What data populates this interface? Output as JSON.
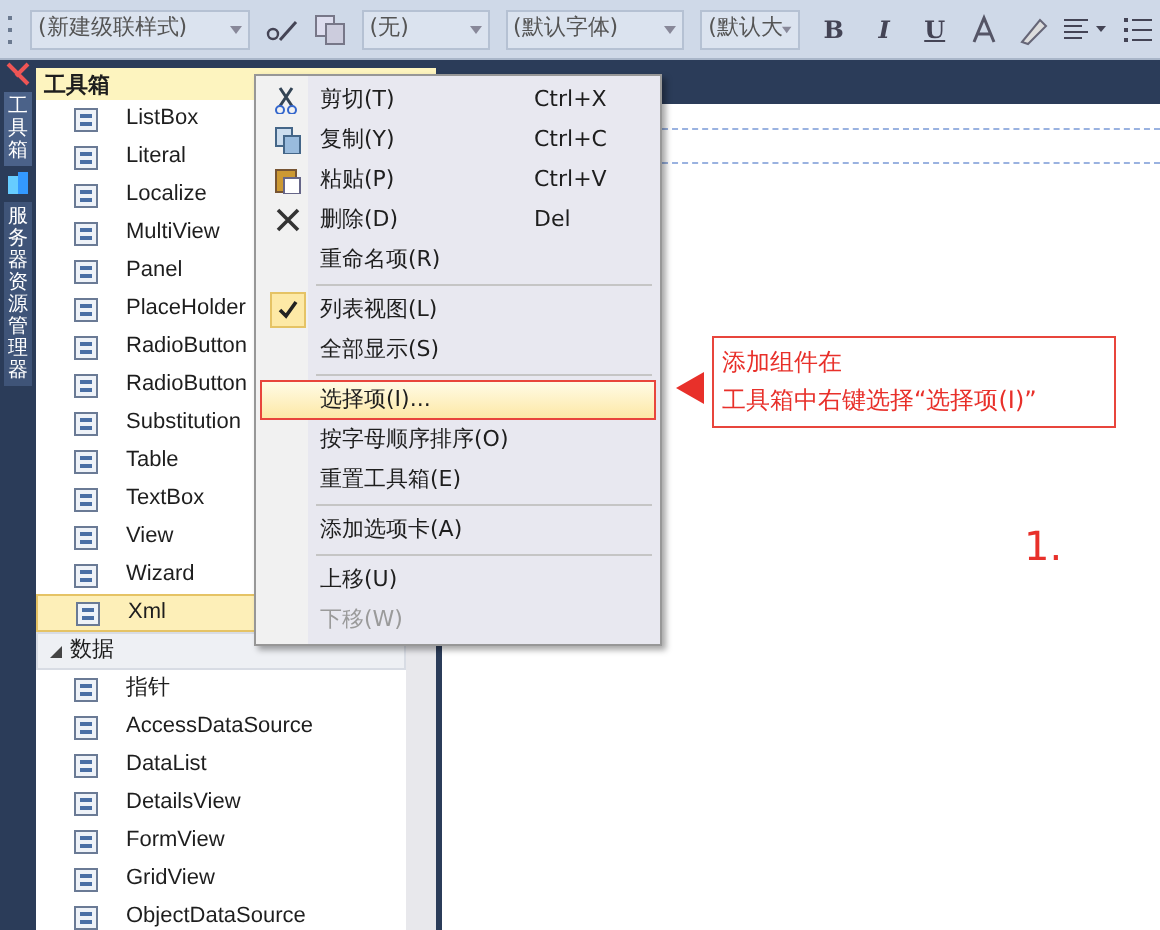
{
  "toolbar": {
    "dropdowns": [
      {
        "value": "(新建级联样式)"
      },
      {
        "value": "(无)"
      },
      {
        "value": "(默认字体)"
      },
      {
        "value": "(默认大"
      }
    ],
    "format_buttons": [
      "B",
      "I",
      "U"
    ]
  },
  "side_tabs": [
    {
      "label": "工具箱",
      "selected": true
    },
    {
      "label": "服务器资源管理器",
      "selected": false
    }
  ],
  "toolbox": {
    "title": "工具箱",
    "items": [
      {
        "label": "ListBox",
        "selected": false
      },
      {
        "label": "Literal",
        "selected": false
      },
      {
        "label": "Localize",
        "selected": false
      },
      {
        "label": "MultiView",
        "selected": false
      },
      {
        "label": "Panel",
        "selected": false
      },
      {
        "label": "PlaceHolder",
        "selected": false
      },
      {
        "label": "RadioButton",
        "selected": false
      },
      {
        "label": "RadioButton",
        "selected": false
      },
      {
        "label": "Substitution",
        "selected": false
      },
      {
        "label": "Table",
        "selected": false
      },
      {
        "label": "TextBox",
        "selected": false
      },
      {
        "label": "View",
        "selected": false
      },
      {
        "label": "Wizard",
        "selected": false
      },
      {
        "label": "Xml",
        "selected": true
      }
    ],
    "groups": [
      {
        "label": "数据",
        "expanded": true,
        "items": [
          {
            "label": "指针",
            "selected": false
          },
          {
            "label": "AccessDataSource",
            "selected": false
          },
          {
            "label": "DataList",
            "selected": false
          },
          {
            "label": "DetailsView",
            "selected": false
          },
          {
            "label": "FormView",
            "selected": false
          },
          {
            "label": "GridView",
            "selected": false
          },
          {
            "label": "ObjectDataSource",
            "selected": false
          }
        ]
      }
    ]
  },
  "context_menu": [
    {
      "kind": "item",
      "label": "剪切(T)",
      "shortcut": "Ctrl+X",
      "checked": false,
      "selected": false,
      "disabled": false
    },
    {
      "kind": "item",
      "label": "复制(Y)",
      "shortcut": "Ctrl+C",
      "checked": false,
      "selected": false,
      "disabled": false
    },
    {
      "kind": "item",
      "label": "粘贴(P)",
      "shortcut": "Ctrl+V",
      "checked": false,
      "selected": false,
      "disabled": false
    },
    {
      "kind": "item",
      "label": "删除(D)",
      "shortcut": "Del",
      "checked": false,
      "selected": false,
      "disabled": false
    },
    {
      "kind": "item",
      "label": "重命名项(R)",
      "checked": false,
      "selected": false,
      "disabled": false
    },
    {
      "kind": "separator"
    },
    {
      "kind": "item",
      "label": "列表视图(L)",
      "checked": true,
      "selected": false,
      "disabled": false
    },
    {
      "kind": "item",
      "label": "全部显示(S)",
      "checked": false,
      "selected": false,
      "disabled": false
    },
    {
      "kind": "separator"
    },
    {
      "kind": "item",
      "label": "选择项(I)...",
      "checked": false,
      "selected": true,
      "disabled": false
    },
    {
      "kind": "item",
      "label": "按字母顺序排序(O)",
      "checked": false,
      "selected": false,
      "disabled": false
    },
    {
      "kind": "item",
      "label": "重置工具箱(E)",
      "checked": false,
      "selected": false,
      "disabled": false
    },
    {
      "kind": "separator"
    },
    {
      "kind": "item",
      "label": "添加选项卡(A)",
      "checked": false,
      "selected": false,
      "disabled": false
    },
    {
      "kind": "separator"
    },
    {
      "kind": "item",
      "label": "上移(U)",
      "checked": false,
      "selected": false,
      "disabled": false
    },
    {
      "kind": "item",
      "label": "下移(W)",
      "checked": false,
      "selected": false,
      "disabled": true
    }
  ],
  "callout": {
    "lines": [
      "添加组件在",
      "工具箱中右键选择“选择项(I)”"
    ]
  },
  "step_label": "1."
}
